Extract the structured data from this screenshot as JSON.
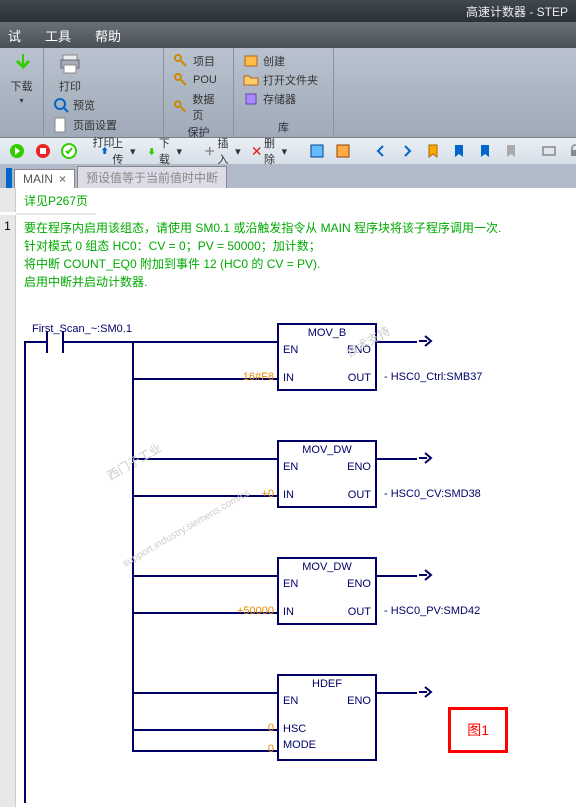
{
  "title": "高速计数器 - STEP",
  "menu": [
    "试",
    "工具",
    "帮助"
  ],
  "ribbon": {
    "groups": [
      {
        "label": "",
        "big": {
          "name": "下载",
          "iconColor": "#3c0"
        }
      },
      {
        "label": "打印",
        "big": {
          "name": "打印"
        },
        "items": [
          "预览",
          "页面设置"
        ]
      },
      {
        "label": "保护",
        "items": [
          "项目",
          "POU",
          "数据页"
        ]
      },
      {
        "label": "库",
        "items": [
          "创建",
          "打开文件夹",
          "存储器"
        ]
      }
    ]
  },
  "qat": [
    "上传",
    "下载",
    "插入",
    "删除"
  ],
  "tabs": [
    {
      "label": "MAIN",
      "active": true
    },
    {
      "label": "预设值等于当前值时中断",
      "active": false
    }
  ],
  "header_comment": "详见P267页",
  "network": {
    "num": "1",
    "comment": [
      "要在程序内启用该组态，请使用 SM0.1 或沿触发指令从 MAIN 程序块将该子程序调用一次.",
      "针对模式 0 组态 HC0：CV = 0；PV = 50000；加计数；",
      "将中断 COUNT_EQ0 附加到事件 12 (HC0 的 CV = PV).",
      "启用中断并启动计数器."
    ],
    "contact": "First_Scan_~:SM0.1",
    "blocks": [
      {
        "title": "MOV_B",
        "in_label": "16#F8",
        "out_label": "HSC0_Ctrl:SMB37",
        "rows": [
          [
            "EN",
            "ENO"
          ],
          [
            "IN",
            "OUT"
          ]
        ]
      },
      {
        "title": "MOV_DW",
        "in_label": "+0",
        "out_label": "HSC0_CV:SMD38",
        "rows": [
          [
            "EN",
            "ENO"
          ],
          [
            "IN",
            "OUT"
          ]
        ]
      },
      {
        "title": "MOV_DW",
        "in_label": "+50000",
        "out_label": "HSC0_PV:SMD42",
        "rows": [
          [
            "EN",
            "ENO"
          ],
          [
            "IN",
            "OUT"
          ]
        ]
      },
      {
        "title": "HDEF",
        "in_rows": [
          [
            "0",
            "HSC"
          ],
          [
            "0",
            "MODE"
          ]
        ],
        "rows": [
          [
            "EN",
            "ENO"
          ]
        ]
      }
    ]
  },
  "fig_label": "图1",
  "watermarks": [
    "技术支持",
    "西门子工业",
    "support.industry.siemens.com/cs"
  ]
}
